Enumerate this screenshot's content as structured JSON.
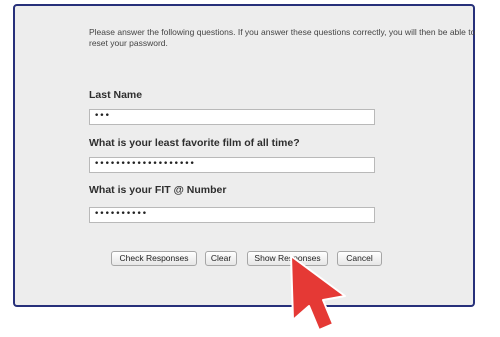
{
  "instructions": "Please answer the following questions. If you answer these questions correctly, you will then be able to reset your password.",
  "questions": [
    {
      "label": "Last Name",
      "value": "•••"
    },
    {
      "label": "What is your least favorite film of all time?",
      "value": "•••••••••••••••••••"
    },
    {
      "label": "What is your FIT @ Number",
      "value": "••••••••••"
    }
  ],
  "buttons": {
    "check": "Check Responses",
    "clear": "Clear",
    "show": "Show Responses",
    "cancel": "Cancel"
  },
  "colors": {
    "panel_border": "#27307a",
    "panel_bg": "#ededed",
    "cursor": "#e53935"
  },
  "icons": {
    "pointer": "cursor-arrow-icon"
  }
}
